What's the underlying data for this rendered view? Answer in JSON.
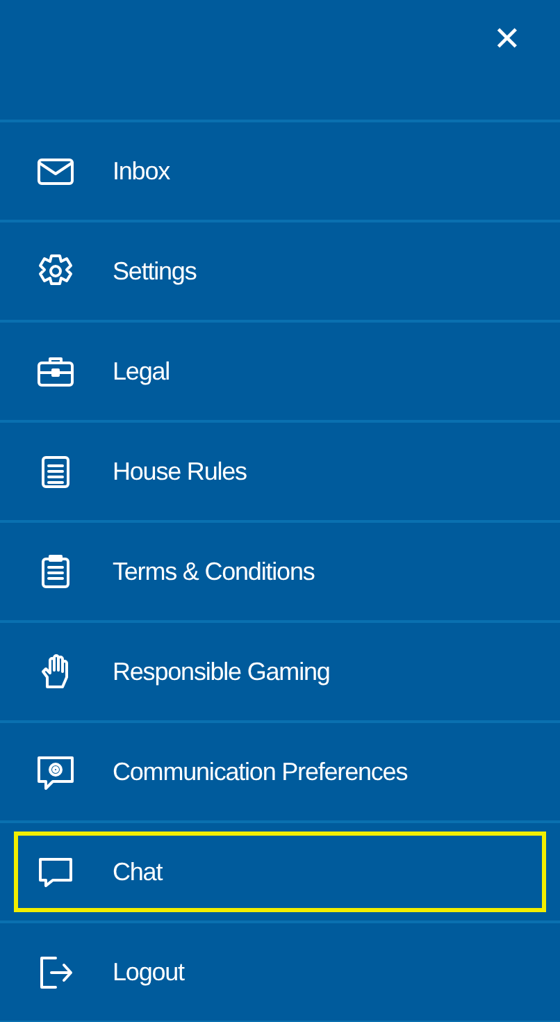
{
  "close_button": {
    "label": "✕"
  },
  "menu": [
    {
      "label": "Inbox",
      "kind": "mail",
      "selected": false
    },
    {
      "label": "Settings",
      "kind": "gear",
      "selected": false
    },
    {
      "label": "Legal",
      "kind": "briefcase",
      "selected": false
    },
    {
      "label": "House Rules",
      "kind": "book",
      "selected": false
    },
    {
      "label": "Terms & Conditions",
      "kind": "clipboard",
      "selected": false
    },
    {
      "label": "Responsible Gaming",
      "kind": "hand",
      "selected": false
    },
    {
      "label": "Communication Preferences",
      "kind": "speech-gear",
      "selected": false
    },
    {
      "label": "Chat",
      "kind": "speech",
      "selected": true
    },
    {
      "label": "Logout",
      "kind": "logout",
      "selected": false
    }
  ]
}
